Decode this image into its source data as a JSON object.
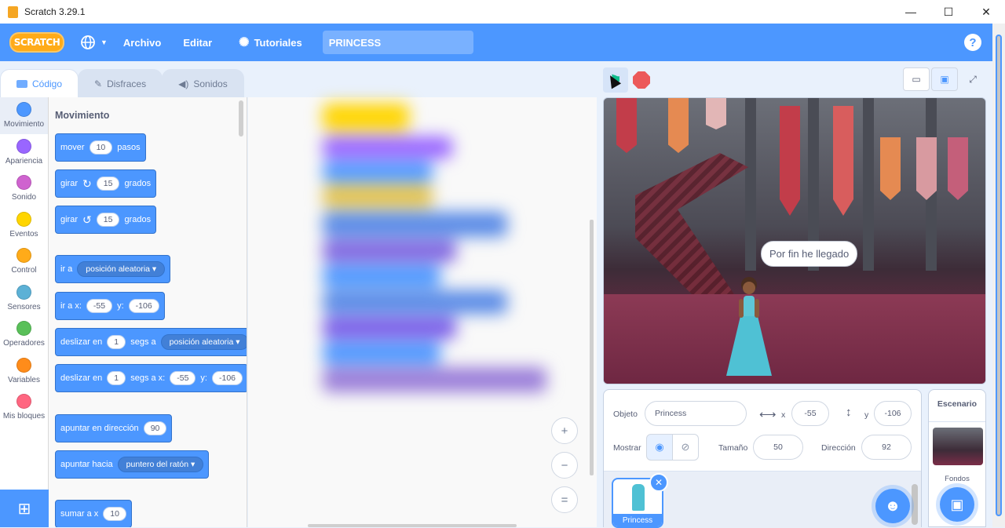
{
  "window": {
    "title": "Scratch 3.29.1",
    "minimize": "—",
    "maximize": "☐",
    "close": "✕"
  },
  "menubar": {
    "logo": "SCRATCH",
    "language_icon": "globe-icon",
    "archivo": "Archivo",
    "editar": "Editar",
    "tutoriales": "Tutoriales",
    "project_name": "PRINCESS",
    "help": "?"
  },
  "tabs": {
    "codigo": "Código",
    "disfraces": "Disfraces",
    "sonidos": "Sonidos"
  },
  "categories": [
    {
      "label": "Movimiento",
      "color": "#4c97ff"
    },
    {
      "label": "Apariencia",
      "color": "#9966ff"
    },
    {
      "label": "Sonido",
      "color": "#cf63cf"
    },
    {
      "label": "Eventos",
      "color": "#ffd500"
    },
    {
      "label": "Control",
      "color": "#ffab19"
    },
    {
      "label": "Sensores",
      "color": "#5cb1d6"
    },
    {
      "label": "Operadores",
      "color": "#59c059"
    },
    {
      "label": "Variables",
      "color": "#ff8c1a"
    },
    {
      "label": "Mis bloques",
      "color": "#ff6680"
    }
  ],
  "palette": {
    "title": "Movimiento",
    "b_mover": {
      "a": "mover",
      "v": "10",
      "b": "pasos"
    },
    "b_girar_r": {
      "a": "girar",
      "v": "15",
      "b": "grados"
    },
    "b_girar_l": {
      "a": "girar",
      "v": "15",
      "b": "grados"
    },
    "b_ira": {
      "a": "ir a",
      "d": "posición aleatoria"
    },
    "b_iraxy": {
      "a": "ir a x:",
      "x": "-55",
      "b": "y:",
      "y": "-106"
    },
    "b_deslizar": {
      "a": "deslizar en",
      "v": "1",
      "b": "segs a",
      "d": "posición aleatoria"
    },
    "b_deslizarxy": {
      "a": "deslizar en",
      "v": "1",
      "b": "segs a x:",
      "x": "-55",
      "c": "y:",
      "y": "-106"
    },
    "b_apuntar": {
      "a": "apuntar en dirección",
      "v": "90"
    },
    "b_apuntarh": {
      "a": "apuntar hacia",
      "d": "puntero del ratón"
    },
    "b_sumar": {
      "a": "sumar a x",
      "v": "10"
    }
  },
  "zoom": {
    "in": "+",
    "out": "−",
    "reset": "="
  },
  "stage": {
    "speech": "Por fin he llegado"
  },
  "sprite_info": {
    "objeto_label": "Objeto",
    "objeto_value": "Princess",
    "x_label": "x",
    "x_value": "-55",
    "y_label": "y",
    "y_value": "-106",
    "mostrar_label": "Mostrar",
    "tamano_label": "Tamaño",
    "tamano_value": "50",
    "direccion_label": "Dirección",
    "direccion_value": "92"
  },
  "sprite_list": [
    {
      "name": "Princess"
    }
  ],
  "stage_pane": {
    "title": "Escenario",
    "fondos_label": "Fondos",
    "fondos_count": ""
  },
  "colors": {
    "accent": "#4c97ff",
    "motion": "#4c97ff",
    "stop": "#ec5959",
    "flag": "#0fbd8c"
  }
}
